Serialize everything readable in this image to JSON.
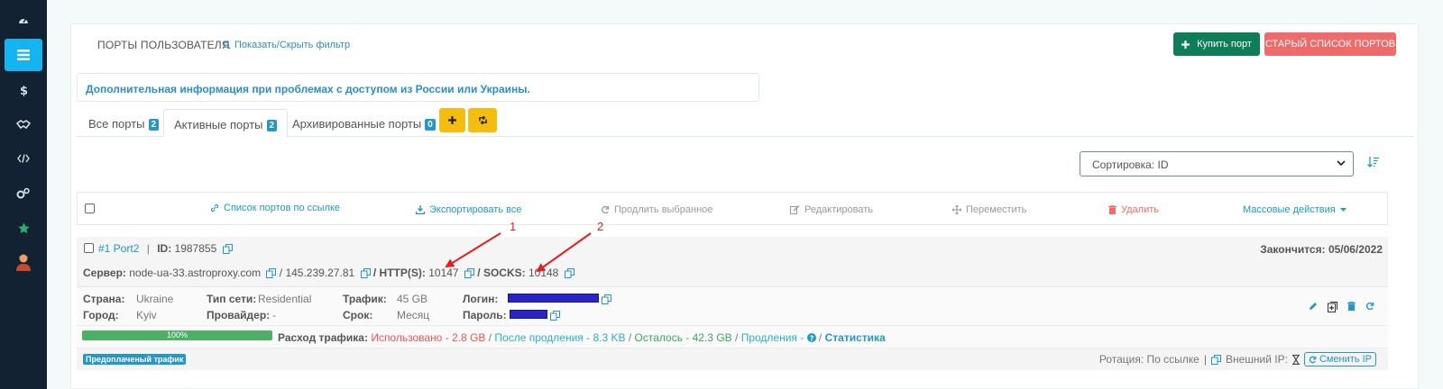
{
  "page": {
    "title": "ПОРТЫ ПОЛЬЗОВАТЕЛЯ",
    "filter_link": "Показать/Скрыть фильтр",
    "buy_port": "Купить порт",
    "old_list": "СТАРЫЙ СПИСОК ПОРТОВ",
    "info": "Дополнительная информация при проблемах с доступом из России или Украины."
  },
  "tabs": [
    {
      "label": "Все порты",
      "count": "2"
    },
    {
      "label": "Активные порты",
      "count": "2"
    },
    {
      "label": "Архивированные порты",
      "count": "0"
    }
  ],
  "sort": {
    "label": "Сортировка: ID"
  },
  "actions": {
    "link_list": "Список портов по ссылке",
    "export_all": "Экспортировать все",
    "extend_selected": "Продлить выбранное",
    "edit": "Редактировать",
    "move": "Переместить",
    "delete": "Удалить",
    "bulk": "Массовые действия"
  },
  "port": {
    "name": "#1 Port2",
    "sep": "|",
    "id_label": "ID:",
    "id": "1987855",
    "expires_label": "Закончится:",
    "expires": "05/06/2022",
    "server_label": "Сервер:",
    "server": "node-ua-33.astroproxy.com",
    "ip": "/ 145.239.27.81",
    "http_label": "/ HTTP(S):",
    "http": "10147",
    "socks_label": "/ SOCKS:",
    "socks": "10148",
    "country_label": "Страна:",
    "country": "Ukraine",
    "city_label": "Город:",
    "city": "Kyiv",
    "net_label": "Тип сети:",
    "net": "Residential",
    "provider_label": "Провайдер:",
    "provider": "-",
    "traffic_label": "Трафик:",
    "traffic": "45 GB",
    "term_label": "Срок:",
    "term": "Месяц",
    "login_label": "Логин:",
    "password_label": "Пароль:",
    "progress_text": "100%",
    "progress_value": 100,
    "traffic_usage_label": "Расход трафика:",
    "used": "Использовано - 2.8 GB",
    "after_ext": "После продления - 8.3 KB",
    "left": "Осталось - 42.3 GB",
    "extensions": "Продления -",
    "stats": "Статистика",
    "slash": "/",
    "prepaid": "Предоплаченый трафик",
    "rotation": "Ротация: По ссылке",
    "ext_ip": "Внешний IP:",
    "change_ip": "Сменить IP"
  },
  "annotations": {
    "first": "1",
    "second": "2"
  },
  "colors": {
    "sidebar": "#122232",
    "accent": "#14b4f0",
    "buy_button": "#0f7d57",
    "old_button": "#ef6b6b",
    "yellow": "#f5bd10",
    "redacted": "#2a24c5",
    "annotation": "#e02020"
  }
}
